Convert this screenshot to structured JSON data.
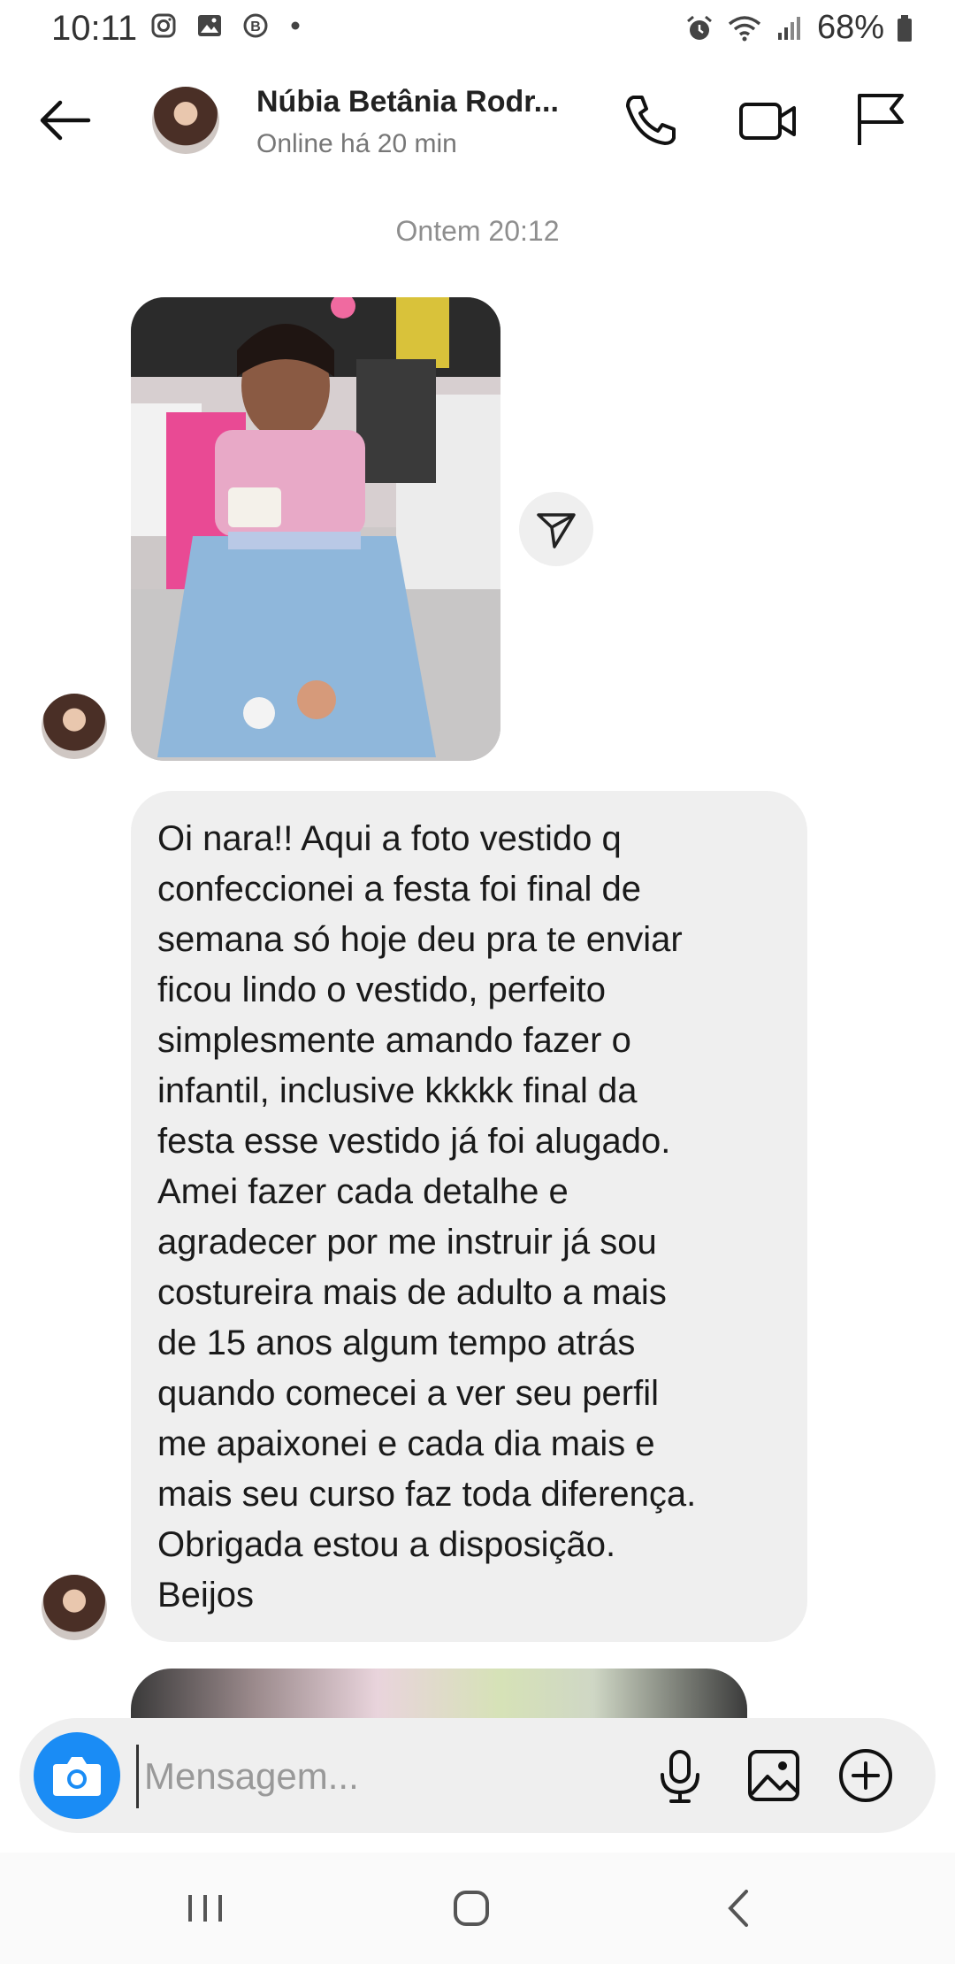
{
  "status_bar": {
    "time": "10:11",
    "battery": "68%",
    "left_icons": [
      "instagram-icon",
      "gallery-icon",
      "b-app-icon",
      "dot-icon"
    ],
    "right_icons": [
      "alarm-icon",
      "wifi-icon",
      "signal-icon",
      "battery-icon"
    ]
  },
  "header": {
    "contact_name": "Núbia Betânia Rodr...",
    "contact_status": "Online há 20 min",
    "actions": [
      "phone-icon",
      "video-icon",
      "flag-icon"
    ]
  },
  "conversation": {
    "timestamp": "Ontem 20:12",
    "message_lines": [
      "Oi nara!! Aqui a foto vestido q",
      "confeccionei a festa foi final de",
      "semana só hoje deu pra te enviar",
      "ficou lindo o vestido, perfeito",
      "simplesmente amando fazer o",
      "infantil, inclusive kkkkk final da",
      "festa esse vestido já foi alugado.",
      "Amei fazer cada detalhe e",
      "agradecer por me instruir já sou",
      "costureira mais de adulto a mais",
      "de 15 anos algum tempo atrás",
      "quando comecei a ver seu perfil",
      "me apaixonei e cada dia mais e",
      "mais seu curso faz toda diferença.",
      "Obrigada estou a disposição.",
      "Beijos"
    ]
  },
  "composer": {
    "placeholder": "Mensagem...",
    "value": "",
    "icons": [
      "camera-icon",
      "microphone-icon",
      "image-icon",
      "plus-circle-icon"
    ]
  },
  "nav_bar": {
    "icons": [
      "recent-apps-icon",
      "home-icon",
      "back-nav-icon"
    ]
  },
  "colors": {
    "accent": "#1a8cf5",
    "bubble": "#efefef",
    "muted_text": "#8e8e8e"
  }
}
